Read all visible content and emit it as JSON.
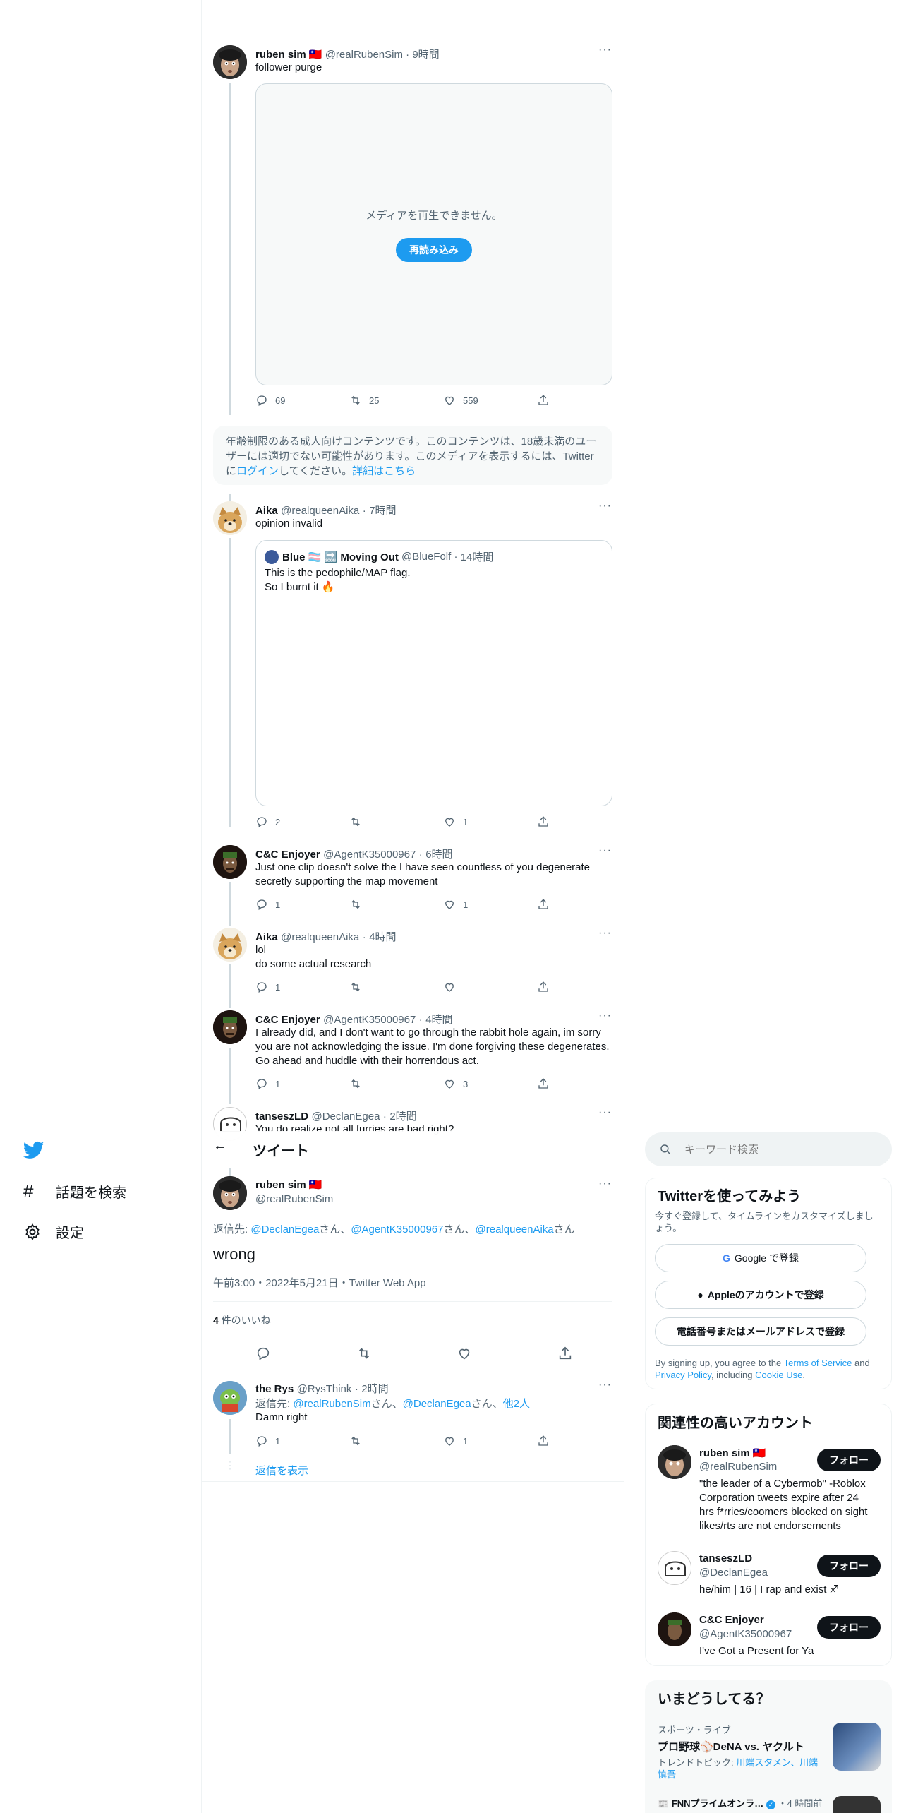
{
  "nav": {
    "explore_label": "話題を検索",
    "settings_label": "設定"
  },
  "header": {
    "title": "ツイート"
  },
  "search": {
    "placeholder": "キーワード検索"
  },
  "tweets": [
    {
      "name": "ruben sim 🇹🇼",
      "handle": "@realRubenSim",
      "time": "9時間",
      "text": "follower purge",
      "media_error": "メディアを再生できません。",
      "reload_label": "再読み込み",
      "replies": "69",
      "retweets": "25",
      "likes": "559"
    },
    {
      "notice_text": "年齢制限のある成人向けコンテンツです。このコンテンツは、18歳未満のユーザーには適切でない可能性があります。このメディアを表示するには、Twitterに",
      "notice_login": "ログイン",
      "notice_mid": "してください。",
      "notice_more": "詳細はこちら"
    },
    {
      "name": "Aika",
      "handle": "@realqueenAika",
      "time": "7時間",
      "text": "opinion invalid",
      "quote_name": "Blue 🏳️‍⚧️ 🔜 Moving Out",
      "quote_handle": "@BlueFolf",
      "quote_time": "14時間",
      "quote_line1": "This is the pedophile/MAP flag.",
      "quote_line2": "So I burnt it 🔥",
      "replies": "2",
      "retweets": "",
      "likes": "1"
    },
    {
      "name": "C&C Enjoyer",
      "handle": "@AgentK35000967",
      "time": "6時間",
      "text": "Just one clip doesn't solve the I have seen countless of you degenerate secretly supporting the map movement",
      "replies": "1",
      "retweets": "",
      "likes": "1"
    },
    {
      "name": "Aika",
      "handle": "@realqueenAika",
      "time": "4時間",
      "line1": "lol",
      "line2": "do some actual research",
      "replies": "1",
      "retweets": "",
      "likes": ""
    },
    {
      "name": "C&C Enjoyer",
      "handle": "@AgentK35000967",
      "time": "4時間",
      "text": "I already did, and I don't want to go through the rabbit hole again, im sorry you are not acknowledging the issue. I'm done forgiving these degenerates. Go ahead and huddle with their horrendous act.",
      "replies": "1",
      "retweets": "",
      "likes": "3"
    },
    {
      "name": "tanseszLD",
      "handle": "@DeclanEgea",
      "time": "2時間",
      "text": "You do realize not all furries are bad right?"
    }
  ],
  "main_tweet": {
    "name": "ruben sim 🇹🇼",
    "handle": "@realRubenSim",
    "reply_to_label": "返信先: ",
    "reply_to_1": "@DeclanEgea",
    "reply_to_sep1": "さん、",
    "reply_to_2": "@AgentK35000967",
    "reply_to_sep2": "さん、",
    "reply_to_3": "@realqueenAika",
    "reply_to_end": "さん",
    "text": "wrong",
    "meta": "午前3:00・2022年5月21日・Twitter Web App",
    "likes_count": "4",
    "likes_label": " 件のいいね"
  },
  "reply": {
    "name": "the Rys",
    "handle": "@RysThink",
    "time": "2時間",
    "reply_to_label": "返信先: ",
    "reply_to_1": "@realRubenSim",
    "reply_to_sep": "さん、",
    "reply_to_2": "@DeclanEgea",
    "reply_to_end": "さん、",
    "reply_to_others": "他2人",
    "text": "Damn right",
    "replies": "1",
    "retweets": "",
    "likes": "1",
    "show_replies": "返信を表示"
  },
  "signup": {
    "title": "Twitterを使ってみよう",
    "subtitle": "今すぐ登録して、タイムラインをカスタマイズしましょう。",
    "google_label": "Google で登録",
    "apple_label": "Appleのアカウントで登録",
    "phone_label": "電話番号またはメールアドレスで登録",
    "terms_prefix": "By signing up, you agree to the ",
    "terms_link": "Terms of Service",
    "terms_and": " and ",
    "privacy_link": "Privacy Policy",
    "terms_including": ", including ",
    "cookie_link": "Cookie Use",
    "terms_end": "."
  },
  "related": {
    "title": "関連性の高いアカウント",
    "follow_label": "フォロー",
    "accounts": [
      {
        "name": "ruben sim 🇹🇼",
        "handle": "@realRubenSim",
        "bio": "\"the leader of a Cybermob\" -Roblox Corporation tweets expire after 24 hrs f*rries/coomers blocked on sight likes/rts are not endorsements"
      },
      {
        "name": "tanseszLD",
        "handle": "@DeclanEgea",
        "bio": "he/him | 16 | I rap and exist ♐"
      },
      {
        "name": "C&C Enjoyer",
        "handle": "@AgentK35000967",
        "bio": "I've Got a Present for Ya"
      }
    ]
  },
  "trends": {
    "title": "いまどうしてる？",
    "item1_category": "スポーツ・ライブ",
    "item1_title": "プロ野球⚾DeNA vs. ヤクルト",
    "item1_sub_prefix": "トレンドトピック: ",
    "item1_sub_link": "川端スタメン、川端慎吾",
    "item2_title": "FNNプライムオンラ…",
    "item2_time": "・4 時間前"
  },
  "colors": {
    "accent": "#1d9bf0",
    "text": "#0f1419",
    "muted": "#536471",
    "border": "#eff3f4"
  }
}
